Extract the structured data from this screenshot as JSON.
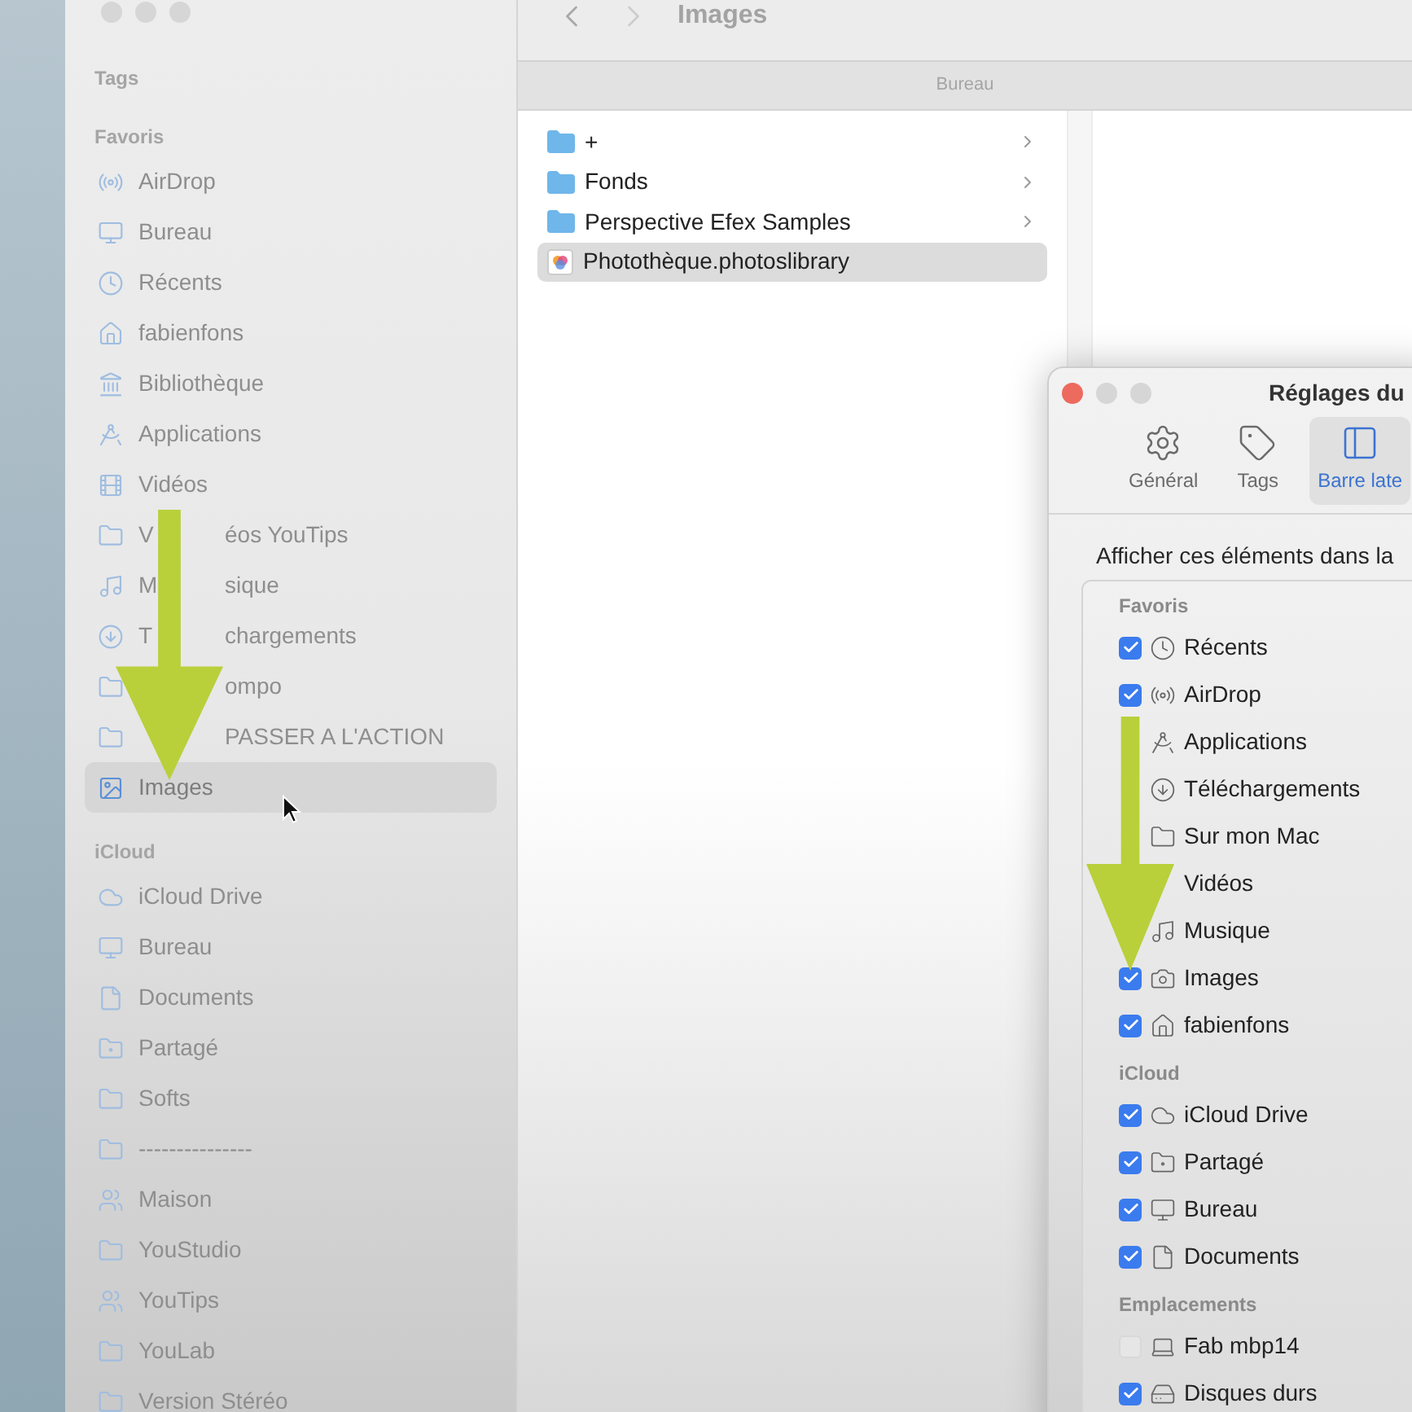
{
  "finder": {
    "toolbar": {
      "title": "Images"
    },
    "sidebar": {
      "sections": [
        {
          "title": "Tags"
        },
        {
          "title": "Favoris",
          "items": [
            {
              "label": "AirDrop",
              "selected": false
            },
            {
              "label": "Bureau",
              "selected": false
            },
            {
              "label": "Récents",
              "selected": false
            },
            {
              "label": "fabienfons",
              "selected": false
            },
            {
              "label": "Bibliothèque",
              "selected": false
            },
            {
              "label": "Applications",
              "selected": false
            },
            {
              "label": "Vidéos",
              "selected": false
            },
            {
              "lead": "V",
              "label": "éos YouTips",
              "selected": false
            },
            {
              "lead": "M",
              "label": "sique",
              "selected": false
            },
            {
              "lead": "T",
              "label": "chargements",
              "selected": false
            },
            {
              "label": "ompo",
              "selected": false
            },
            {
              "label": "PASSER A L'ACTION",
              "selected": false
            },
            {
              "label": "Images",
              "selected": true
            }
          ]
        },
        {
          "title": "iCloud",
          "items": [
            {
              "label": "iCloud Drive",
              "selected": false
            },
            {
              "label": "Bureau",
              "selected": false
            },
            {
              "label": "Documents",
              "selected": false
            },
            {
              "label": "Partagé",
              "selected": false
            },
            {
              "label": "Softs",
              "selected": false
            },
            {
              "label": "---------------",
              "selected": false
            },
            {
              "label": "Maison",
              "selected": false
            },
            {
              "label": "YouStudio",
              "selected": false
            },
            {
              "label": "YouTips",
              "selected": false
            },
            {
              "label": "YouLab",
              "selected": false
            },
            {
              "label": "Version Stéréo",
              "selected": false
            }
          ]
        }
      ]
    },
    "path_bar": "Bureau",
    "column": [
      {
        "label": "+",
        "kind": "folder",
        "selected": false
      },
      {
        "label": "Fonds",
        "kind": "folder",
        "selected": false
      },
      {
        "label": "Perspective Efex Samples",
        "kind": "folder",
        "selected": false
      },
      {
        "label": "Photothèque.photoslibrary",
        "kind": "library",
        "selected": true
      }
    ]
  },
  "settings": {
    "title": "Réglages du",
    "tabs": [
      {
        "label": "Général",
        "selected": false
      },
      {
        "label": "Tags",
        "selected": false
      },
      {
        "label": "Barre late",
        "selected": true
      }
    ],
    "intro": "Afficher ces éléments dans la",
    "sections": [
      {
        "title": "Favoris",
        "items": [
          {
            "label": "Récents",
            "checked": true
          },
          {
            "label": "AirDrop",
            "checked": true
          },
          {
            "label": "Applications"
          },
          {
            "label": "Téléchargements"
          },
          {
            "label": "Sur mon Mac"
          },
          {
            "label": "Vidéos"
          },
          {
            "label": "Musique"
          },
          {
            "label": "Images",
            "checked": true
          },
          {
            "label": "fabienfons",
            "checked": true
          }
        ]
      },
      {
        "title": "iCloud",
        "items": [
          {
            "label": "iCloud Drive",
            "checked": true
          },
          {
            "label": "Partagé",
            "checked": true
          },
          {
            "label": "Bureau",
            "checked": true
          },
          {
            "label": "Documents",
            "checked": true
          }
        ]
      },
      {
        "title": "Emplacements",
        "items": [
          {
            "label": "Fab mbp14",
            "checked": false
          },
          {
            "label": "Disques durs",
            "checked": true
          }
        ]
      }
    ]
  }
}
